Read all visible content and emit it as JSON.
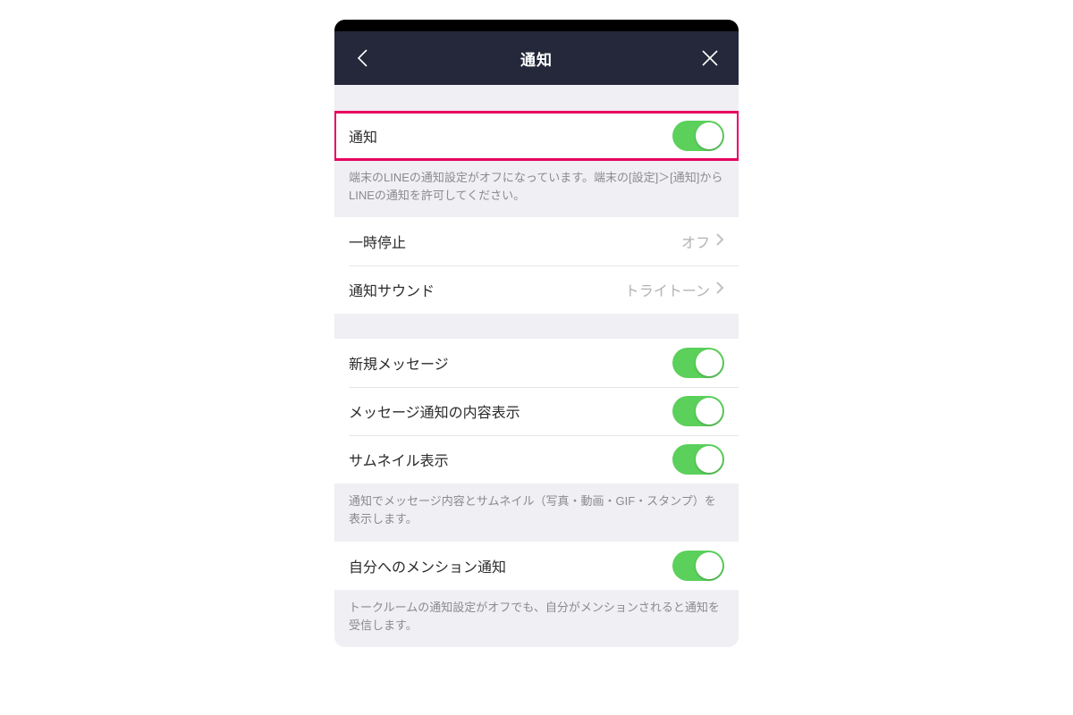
{
  "header": {
    "title": "通知"
  },
  "section1": {
    "toggle_label": "通知",
    "note": "端末のLINEの通知設定がオフになっています。端末の[設定]＞[通知]からLINEの通知を許可してください。"
  },
  "section2": {
    "pause_label": "一時停止",
    "pause_value": "オフ",
    "sound_label": "通知サウンド",
    "sound_value": "トライトーン"
  },
  "section3": {
    "new_msg_label": "新規メッセージ",
    "content_label": "メッセージ通知の内容表示",
    "thumb_label": "サムネイル表示",
    "note": "通知でメッセージ内容とサムネイル（写真・動画・GIF・スタンプ）を表示します。"
  },
  "section4": {
    "mention_label": "自分へのメンション通知",
    "note": "トークルームの通知設定がオフでも、自分がメンションされると通知を受信します。"
  }
}
